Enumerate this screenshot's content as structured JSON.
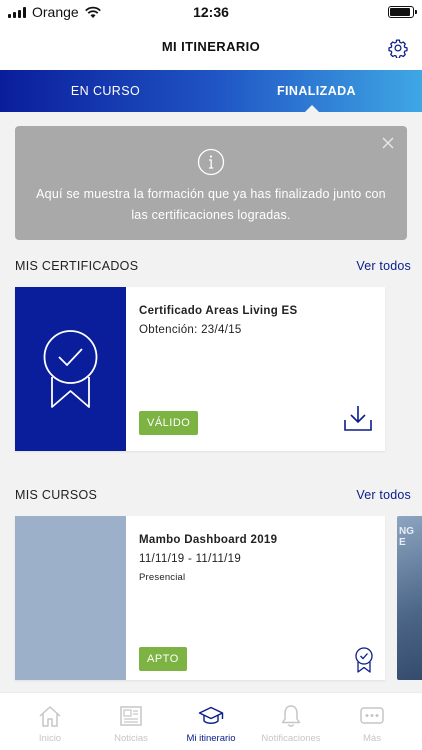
{
  "status_bar": {
    "carrier": "Orange",
    "time": "12:36"
  },
  "header": {
    "title": "MI ITINERARIO"
  },
  "tabs": [
    {
      "label": "EN CURSO",
      "active": false
    },
    {
      "label": "FINALIZADA",
      "active": true
    }
  ],
  "info": {
    "text": "Aquí se muestra la formación que ya has finalizado junto con las certificaciones logradas."
  },
  "certificates": {
    "title": "MIS CERTIFICADOS",
    "link": "Ver todos",
    "items": [
      {
        "title": "Certificado Areas Living ES",
        "subtitle": "Obtención: 23/4/15",
        "badge": "VÁLIDO"
      }
    ]
  },
  "courses": {
    "title": "MIS CURSOS",
    "link": "Ver todos",
    "items": [
      {
        "title": "Mambo Dashboard 2019",
        "dates": "11/11/19 - 11/11/19",
        "mode": "Presencial",
        "badge": "APTO"
      }
    ],
    "peek_text": "NG E"
  },
  "tabbar": [
    {
      "label": "Inicio",
      "icon": "home-icon",
      "active": false
    },
    {
      "label": "Noticias",
      "icon": "news-icon",
      "active": false
    },
    {
      "label": "Mi itinerario",
      "icon": "graduation-cap-icon",
      "active": true
    },
    {
      "label": "Notificaciones",
      "icon": "bell-icon",
      "active": false
    },
    {
      "label": "Más",
      "icon": "more-icon",
      "active": false
    }
  ],
  "colors": {
    "primary": "#0a1d9a",
    "gradient_end": "#3fa7e4",
    "badge_green": "#7cb342",
    "link": "#0a1d8a",
    "info_bg": "#a9a9a9"
  }
}
